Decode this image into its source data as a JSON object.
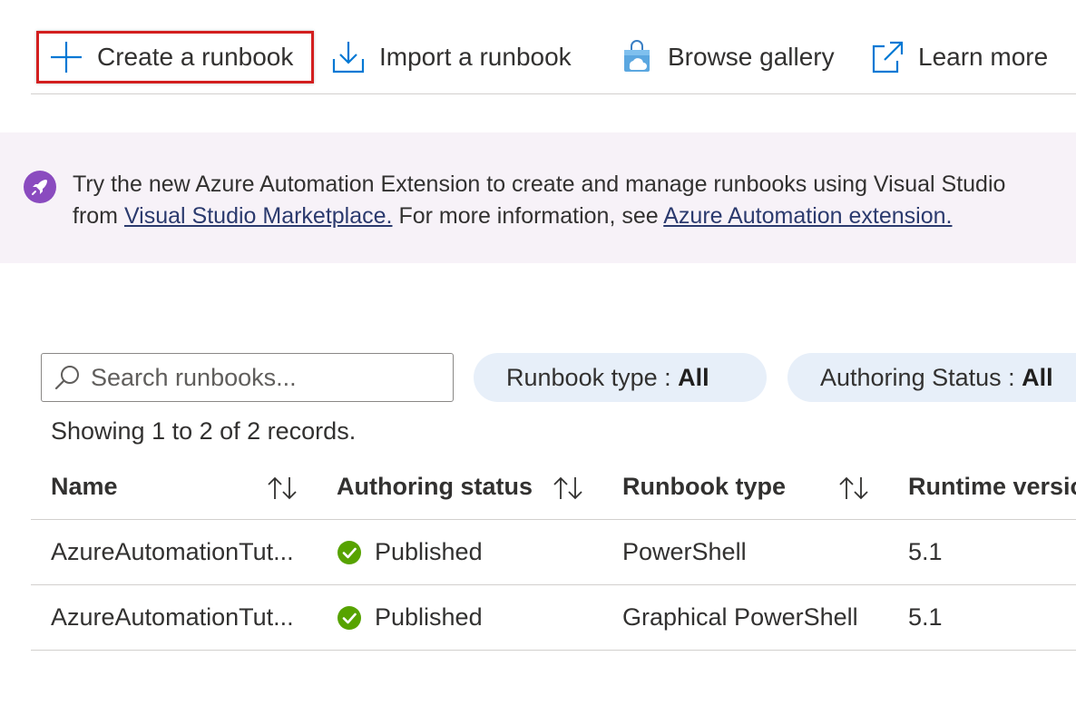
{
  "toolbar": {
    "create_label": "Create a runbook",
    "import_label": "Import a runbook",
    "browse_label": "Browse gallery",
    "learn_label": "Learn more"
  },
  "banner": {
    "text_before": "Try the new Azure Automation Extension to create and manage runbooks using Visual Studio",
    "text_from": "from ",
    "link_marketplace": "Visual Studio Marketplace.",
    "text_more": " For more information, see ",
    "link_extension": "Azure Automation extension."
  },
  "filters": {
    "search_placeholder": "Search runbooks...",
    "runbook_type_label": "Runbook type : ",
    "runbook_type_value": "All",
    "authoring_status_label": "Authoring Status : ",
    "authoring_status_value": "All"
  },
  "records_text": "Showing 1 to 2 of 2 records.",
  "table": {
    "headers": [
      "Name",
      "Authoring status",
      "Runbook type",
      "Runtime version"
    ],
    "rows": [
      {
        "name": "AzureAutomationTut...",
        "status": "Published",
        "type": "PowerShell",
        "runtime": "5.1"
      },
      {
        "name": "AzureAutomationTut...",
        "status": "Published",
        "type": "Graphical PowerShell",
        "runtime": "5.1"
      }
    ]
  },
  "colors": {
    "accent": "#0078d4",
    "highlight_border": "#d31f1f",
    "banner_bg": "#f7f2f8",
    "rocket": "#8a4bbf",
    "success": "#57a300"
  }
}
